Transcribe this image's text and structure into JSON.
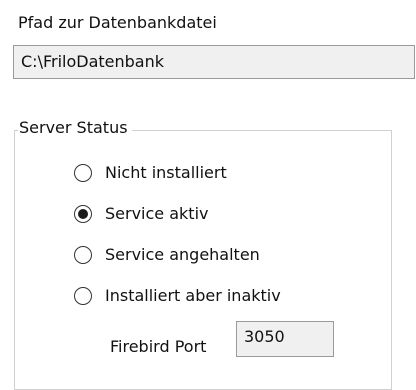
{
  "database_path": {
    "label": "Pfad zur Datenbankdatei",
    "value": "C:\\FriloDatenbank"
  },
  "server_status": {
    "title": "Server Status",
    "options": [
      {
        "label": "Nicht installiert",
        "selected": false
      },
      {
        "label": "Service aktiv",
        "selected": true
      },
      {
        "label": "Service angehalten",
        "selected": false
      },
      {
        "label": "Installiert aber inaktiv",
        "selected": false
      }
    ],
    "firebird_port": {
      "label": "Firebird Port",
      "value": "3050"
    }
  }
}
